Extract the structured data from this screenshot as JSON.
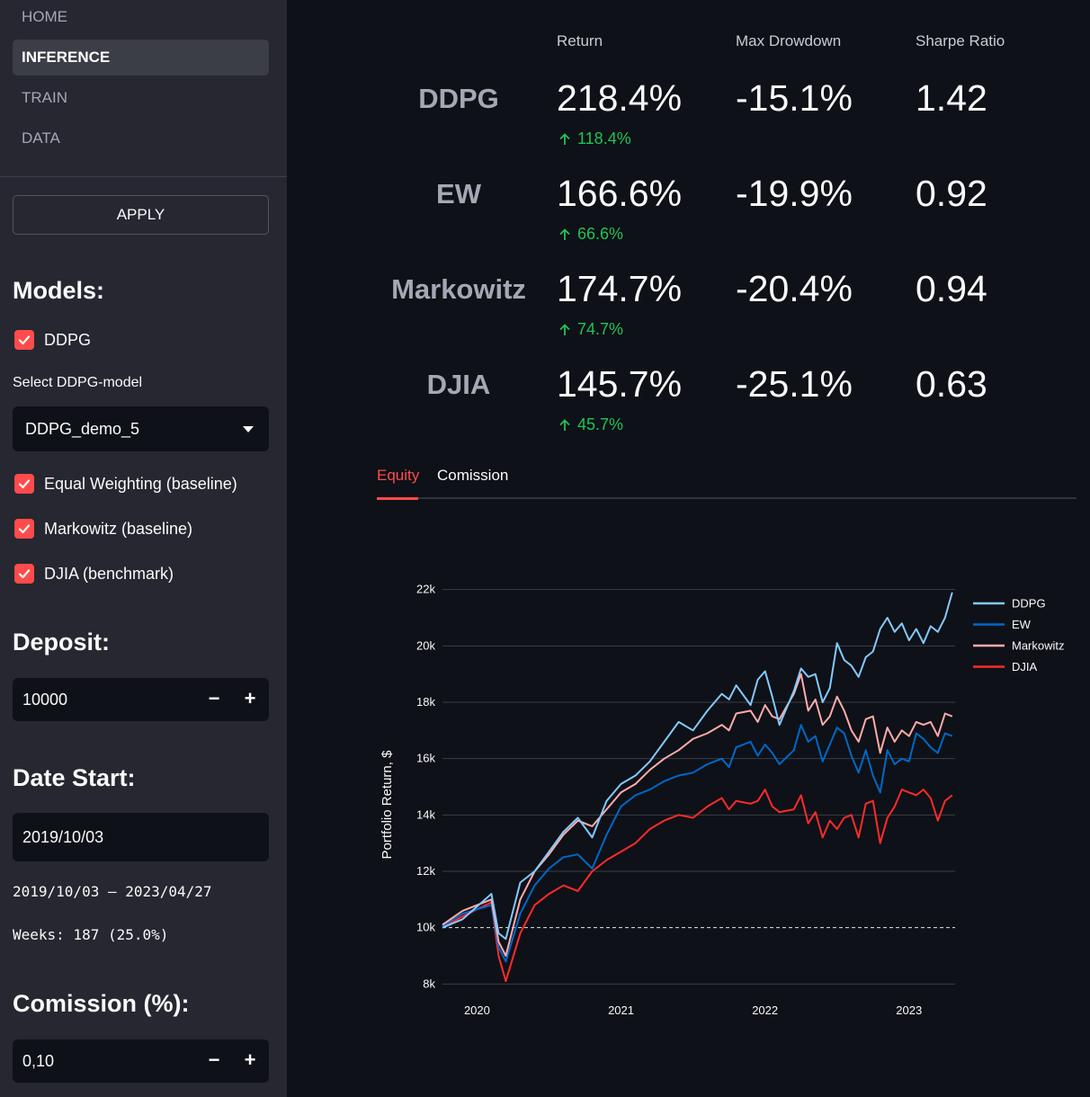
{
  "nav": {
    "items": [
      {
        "label": "HOME",
        "active": false
      },
      {
        "label": "INFERENCE",
        "active": true
      },
      {
        "label": "TRAIN",
        "active": false
      },
      {
        "label": "DATA",
        "active": false
      }
    ]
  },
  "sidebar": {
    "apply_label": "APPLY",
    "models_title": "Models:",
    "models": [
      {
        "label": "DDPG",
        "checked": true
      },
      {
        "label": "Equal Weighting (baseline)",
        "checked": true
      },
      {
        "label": "Markowitz (baseline)",
        "checked": true
      },
      {
        "label": "DJIA (benchmark)",
        "checked": true
      }
    ],
    "select_label": "Select DDPG-model",
    "select_value": "DDPG_demo_5",
    "deposit_title": "Deposit:",
    "deposit_value": "10000",
    "date_title": "Date Start:",
    "date_value": "2019/10/03",
    "date_range": "2019/10/03 – 2023/04/27",
    "weeks": "Weeks: 187 (25.0%)",
    "commission_title": "Comission (%):",
    "commission_value": "0,10",
    "minus": "−",
    "plus": "+"
  },
  "metrics": {
    "headers": {
      "ret": "Return",
      "dd": "Max Drowdown",
      "sharpe": "Sharpe Ratio"
    },
    "rows": [
      {
        "name": "DDPG",
        "ret": "218.4%",
        "delta": "118.4%",
        "dd": "-15.1%",
        "sharpe": "1.42"
      },
      {
        "name": "EW",
        "ret": "166.6%",
        "delta": "66.6%",
        "dd": "-19.9%",
        "sharpe": "0.92"
      },
      {
        "name": "Markowitz",
        "ret": "174.7%",
        "delta": "74.7%",
        "dd": "-20.4%",
        "sharpe": "0.94"
      },
      {
        "name": "DJIA",
        "ret": "145.7%",
        "delta": "45.7%",
        "dd": "-25.1%",
        "sharpe": "0.63"
      }
    ]
  },
  "tabs": [
    {
      "label": "Equity",
      "active": true
    },
    {
      "label": "Comission",
      "active": false
    }
  ],
  "colors": {
    "accent": "#ff4b4b",
    "positive": "#21c354"
  },
  "chart_data": {
    "type": "line",
    "title": "",
    "xlabel": "",
    "ylabel": "Portfolio Return, $",
    "xlim": [
      2019.76,
      2023.32
    ],
    "ylim": [
      7500,
      22500
    ],
    "x_ticks": [
      2020,
      2021,
      2022,
      2023
    ],
    "x_tick_labels": [
      "2020",
      "2021",
      "2022",
      "2023"
    ],
    "y_ticks": [
      8000,
      10000,
      12000,
      14000,
      16000,
      18000,
      20000,
      22000
    ],
    "y_tick_labels": [
      "8k",
      "10k",
      "12k",
      "14k",
      "16k",
      "18k",
      "20k",
      "22k"
    ],
    "reference_line": 10000,
    "grid": true,
    "legend_position": "top-right",
    "series": [
      {
        "name": "DDPG",
        "color": "#83c9ff",
        "x": [
          2019.76,
          2019.9,
          2020.1,
          2020.15,
          2020.2,
          2020.3,
          2020.4,
          2020.5,
          2020.6,
          2020.7,
          2020.8,
          2020.9,
          2021.0,
          2021.1,
          2021.2,
          2021.3,
          2021.4,
          2021.5,
          2021.6,
          2021.7,
          2021.75,
          2021.8,
          2021.9,
          2021.95,
          2022.0,
          2022.05,
          2022.1,
          2022.2,
          2022.25,
          2022.3,
          2022.35,
          2022.4,
          2022.45,
          2022.5,
          2022.55,
          2022.6,
          2022.65,
          2022.7,
          2022.75,
          2022.8,
          2022.85,
          2022.9,
          2022.95,
          2023.0,
          2023.05,
          2023.1,
          2023.15,
          2023.2,
          2023.25,
          2023.3
        ],
        "values": [
          10000,
          10300,
          11200,
          9800,
          9600,
          11600,
          12000,
          12700,
          13400,
          13900,
          13200,
          14500,
          15100,
          15400,
          15900,
          16600,
          17300,
          17000,
          17700,
          18300,
          18100,
          18600,
          17900,
          18800,
          19100,
          18200,
          17200,
          18400,
          19200,
          18900,
          19000,
          18000,
          18500,
          20100,
          19500,
          19300,
          18900,
          19600,
          19800,
          20600,
          21000,
          20500,
          20800,
          20200,
          20600,
          20100,
          20700,
          20500,
          21000,
          21900
        ]
      },
      {
        "name": "EW",
        "color": "#0068c9",
        "x": [
          2019.76,
          2019.9,
          2020.1,
          2020.15,
          2020.2,
          2020.3,
          2020.4,
          2020.5,
          2020.6,
          2020.7,
          2020.8,
          2020.9,
          2021.0,
          2021.1,
          2021.2,
          2021.3,
          2021.4,
          2021.5,
          2021.6,
          2021.7,
          2021.75,
          2021.8,
          2021.9,
          2021.95,
          2022.0,
          2022.05,
          2022.1,
          2022.2,
          2022.25,
          2022.3,
          2022.35,
          2022.4,
          2022.45,
          2022.5,
          2022.55,
          2022.6,
          2022.65,
          2022.7,
          2022.75,
          2022.8,
          2022.85,
          2022.9,
          2022.95,
          2023.0,
          2023.05,
          2023.1,
          2023.15,
          2023.2,
          2023.25,
          2023.3
        ],
        "values": [
          10050,
          10500,
          10800,
          9300,
          8800,
          10500,
          11500,
          12100,
          12500,
          12600,
          12100,
          13300,
          14300,
          14700,
          14900,
          15200,
          15400,
          15500,
          15800,
          16000,
          15700,
          16400,
          16600,
          16100,
          16500,
          16200,
          15800,
          16300,
          17200,
          16600,
          16800,
          15900,
          16500,
          17100,
          16900,
          16100,
          15500,
          16300,
          15400,
          14800,
          16300,
          15800,
          16000,
          15900,
          16900,
          16700,
          16400,
          16200,
          16900,
          16800
        ]
      },
      {
        "name": "Markowitz",
        "color": "#ffabab",
        "x": [
          2019.76,
          2019.9,
          2020.1,
          2020.15,
          2020.2,
          2020.3,
          2020.4,
          2020.5,
          2020.6,
          2020.7,
          2020.8,
          2020.9,
          2021.0,
          2021.1,
          2021.2,
          2021.3,
          2021.4,
          2021.5,
          2021.6,
          2021.7,
          2021.75,
          2021.8,
          2021.9,
          2021.95,
          2022.0,
          2022.05,
          2022.1,
          2022.2,
          2022.25,
          2022.3,
          2022.35,
          2022.4,
          2022.45,
          2022.5,
          2022.55,
          2022.6,
          2022.65,
          2022.7,
          2022.75,
          2022.8,
          2022.85,
          2022.9,
          2022.95,
          2023.0,
          2023.05,
          2023.1,
          2023.15,
          2023.2,
          2023.25,
          2023.3
        ],
        "values": [
          10100,
          10600,
          11000,
          9500,
          9000,
          11000,
          12000,
          12600,
          13300,
          13800,
          13600,
          14200,
          14800,
          15100,
          15600,
          16000,
          16300,
          16700,
          16900,
          17200,
          17000,
          17600,
          17700,
          17300,
          17900,
          17500,
          17400,
          18300,
          19000,
          17700,
          18100,
          17200,
          17500,
          18200,
          17700,
          17000,
          16600,
          17400,
          17500,
          16200,
          17100,
          16600,
          17000,
          16800,
          17300,
          17200,
          17300,
          16800,
          17600,
          17500
        ]
      },
      {
        "name": "DJIA",
        "color": "#ff2b2b",
        "x": [
          2019.76,
          2019.9,
          2020.1,
          2020.15,
          2020.2,
          2020.3,
          2020.4,
          2020.5,
          2020.6,
          2020.7,
          2020.8,
          2020.9,
          2021.0,
          2021.1,
          2021.2,
          2021.3,
          2021.4,
          2021.5,
          2021.6,
          2021.7,
          2021.75,
          2021.8,
          2021.9,
          2021.95,
          2022.0,
          2022.05,
          2022.1,
          2022.2,
          2022.25,
          2022.3,
          2022.35,
          2022.4,
          2022.45,
          2022.5,
          2022.55,
          2022.6,
          2022.65,
          2022.7,
          2022.75,
          2022.8,
          2022.85,
          2022.9,
          2022.95,
          2023.0,
          2023.05,
          2023.1,
          2023.15,
          2023.2,
          2023.25,
          2023.3
        ],
        "values": [
          10000,
          10400,
          10900,
          9000,
          8100,
          9800,
          10800,
          11200,
          11500,
          11300,
          12000,
          12400,
          12700,
          13000,
          13500,
          13800,
          14000,
          13900,
          14300,
          14600,
          14200,
          14500,
          14400,
          14500,
          14900,
          14300,
          14100,
          14200,
          14700,
          13700,
          14100,
          13200,
          13800,
          13500,
          13900,
          14000,
          13200,
          14400,
          14500,
          13000,
          13900,
          14300,
          14900,
          14800,
          14700,
          14900,
          14600,
          13800,
          14500,
          14700
        ]
      }
    ]
  }
}
